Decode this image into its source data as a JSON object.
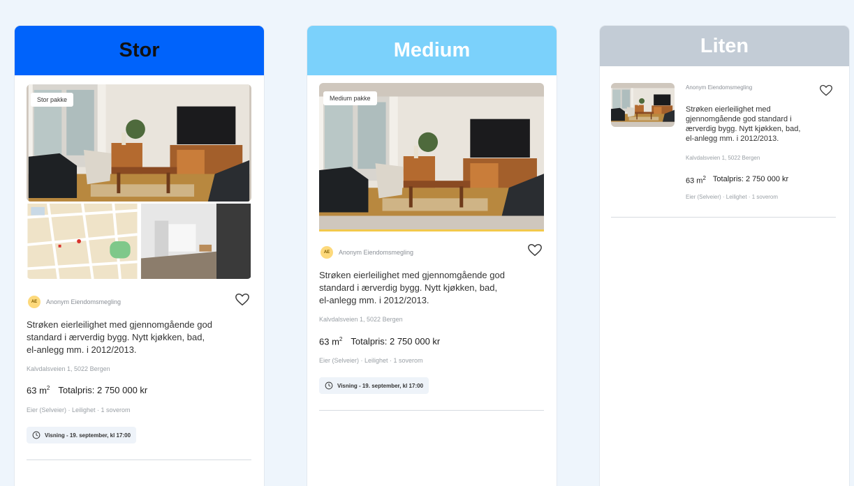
{
  "packages": {
    "stor": {
      "header": "Stor",
      "badge": "Stor pakke",
      "agency": "Anonym Eiendomsmegling",
      "logo_text": "AE",
      "title_lines": [
        "Strøken eierleilighet med gjennomgående god",
        "standard i ærverdig bygg. Nytt kjøkken, bad,",
        "el-anlegg mm. i 2012/2013."
      ],
      "address": "Kalvdalsveien 1, 5022 Bergen",
      "area": "63 m",
      "area_sup": "2",
      "price": "Totalpris: 2 750 000 kr",
      "details": "Eier (Selveier) · Leilighet · 1 soverom",
      "viewing": "Visning - 19. september, kl 17:00"
    },
    "medium": {
      "header": "Medium",
      "badge": "Medium pakke",
      "agency": "Anonym Eiendomsmegling",
      "logo_text": "AE",
      "title_lines": [
        "Strøken eierleilighet med gjennomgående god",
        "standard i ærverdig bygg. Nytt kjøkken, bad,",
        "el-anlegg mm. i 2012/2013."
      ],
      "address": "Kalvdalsveien 1, 5022 Bergen",
      "area": "63 m",
      "area_sup": "2",
      "price": "Totalpris: 2 750 000 kr",
      "details": "Eier (Selveier) · Leilighet · 1 soverom",
      "viewing": "Visning - 19. september, kl 17:00"
    },
    "liten": {
      "header": "Liten",
      "agency": "Anonym Eiendomsmegling",
      "title_lines": [
        "Strøken eierleilighet med",
        "gjennomgående god standard i",
        "ærverdig bygg. Nytt kjøkken, bad,",
        "el-anlegg mm. i 2012/2013."
      ],
      "address": "Kalvdalsveien 1, 5022 Bergen",
      "area": "63 m",
      "area_sup": "2",
      "price": "Totalpris: 2 750 000 kr",
      "details": "Eier (Selveier) · Leilighet · 1 soverom"
    }
  },
  "colors": {
    "stor_header": "#0063fb",
    "medium_header": "#7bd1fb",
    "liten_header": "#c3ccd6",
    "page_background": "#eef5fc"
  }
}
